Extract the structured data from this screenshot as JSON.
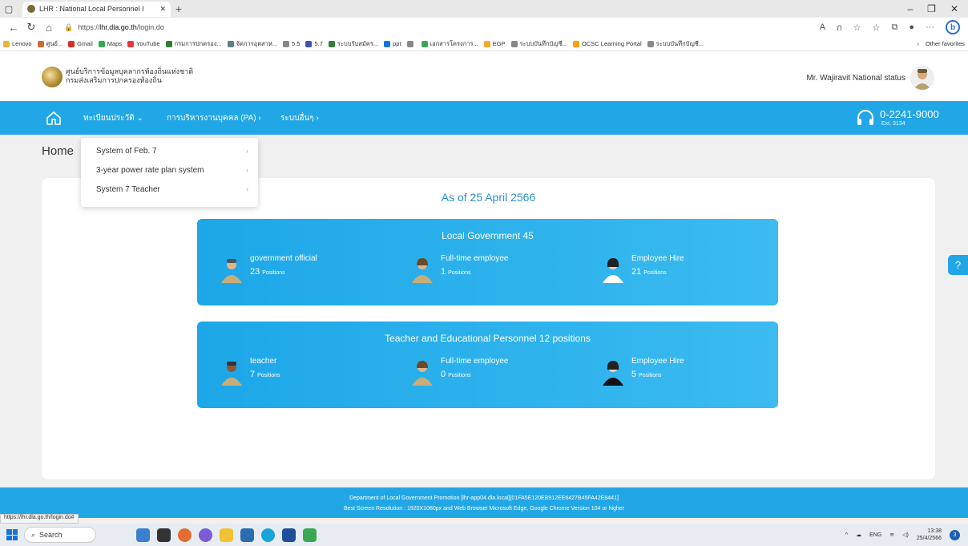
{
  "browser": {
    "tab_title": "LHR : National Local Personnel I",
    "url_prefix": "https://",
    "url_host": "lhr.dla.go.th",
    "url_path": "/login.do",
    "favorites": [
      "Lenovo",
      "ศูนย์...",
      "Gmail",
      "Maps",
      "YouTube",
      "กรมการปกครอง...",
      "จัดการอุตสาห...",
      "5.5",
      "5.7",
      "ระบบรับสมัคร...",
      "ppt",
      "",
      "เอกสารโครงการ...",
      "EGP",
      "ระบบบันทึกบัญชี...",
      "OCSC Learning Portal",
      "ระบบบันทึกบัญชี..."
    ],
    "other_favorites": "Other favorites",
    "status_url": "https://lhr.dla.go.th/login.do#"
  },
  "header": {
    "org_line1": "ศูนย์บริการข้อมูลบุคลากรท้องถิ่นแห่งชาติ",
    "org_line2": "กรมส่งเสริมการปกครองท้องถิ่น",
    "user_name": "Mr. Wajiravit National status"
  },
  "nav": {
    "item1": "ทะเบียนประวัติ",
    "item2": "การบริหารงานบุคคล (PA)",
    "item3": "ระบบอื่นๆ",
    "phone": "0-2241-9000",
    "ext": "Ext. 3134"
  },
  "dropdown": {
    "items": [
      "System of Feb. 7",
      "3-year power rate plan system",
      "System 7 Teacher"
    ]
  },
  "main": {
    "title": "Home",
    "as_of": "As of 25 April 2566",
    "unit": "Positions",
    "panels": [
      {
        "title": "Local Government 45",
        "stats": [
          {
            "label": "government official",
            "count": "23"
          },
          {
            "label": "Full-time employee",
            "count": "1"
          },
          {
            "label": "Employee Hire",
            "count": "21"
          }
        ]
      },
      {
        "title": "Teacher and Educational Personnel 12 positions",
        "stats": [
          {
            "label": "teacher",
            "count": "7"
          },
          {
            "label": "Full-time employee",
            "count": "0"
          },
          {
            "label": "Employee Hire",
            "count": "5"
          }
        ]
      }
    ]
  },
  "footer": {
    "line1": "Department of Local Government Promotion [lhr-app04.dla.local][01FA5E120EB912EE6427B45FA42E8441]",
    "line2": "Best Screen Resolution : 1920X1080px and Web Browser Microsoft Edge, Google Chrome Version 104 or higher"
  },
  "taskbar": {
    "search": "Search",
    "lang": "ENG",
    "time": "13:38",
    "date": "25/4/2566",
    "notif_count": "3"
  },
  "colors": {
    "primary": "#22a7e6",
    "accent_text": "#2a90cf"
  }
}
